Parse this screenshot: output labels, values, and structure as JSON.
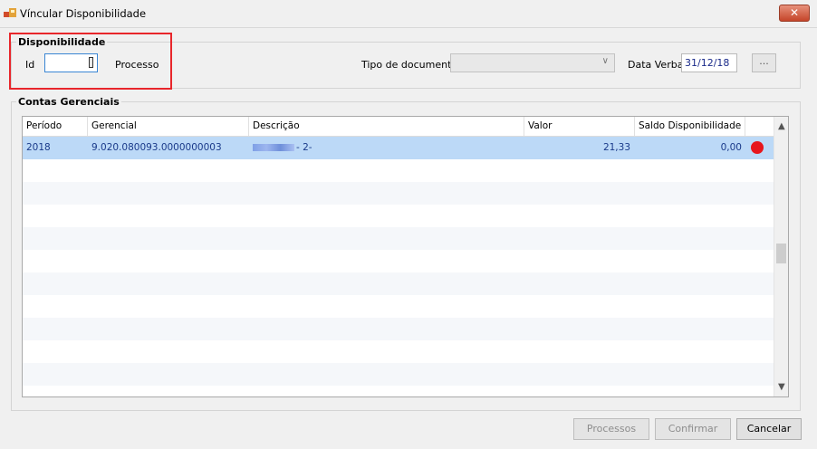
{
  "window": {
    "title": "Víncular Disponibilidade",
    "close_label": "✕"
  },
  "disponibilidade": {
    "legend": "Disponibilidade",
    "id_label": "Id",
    "id_value": "",
    "processo_label": "Processo",
    "tipo_documento_label": "Tipo de documento",
    "tipo_documento_value": "",
    "data_verba_label": "Data Verba",
    "data_verba_value": "31/12/18",
    "browse_label": "..."
  },
  "contas": {
    "legend": "Contas Gerenciais",
    "columns": [
      "Período",
      "Gerencial",
      "Descrição",
      "Valor",
      "Saldo Disponibilidade"
    ],
    "rows": [
      {
        "periodo": "2018",
        "gerencial": "9.020.080093.0000000003",
        "descricao": " - 2-",
        "valor": "21,33",
        "saldo": "0,00",
        "status_color": "#e7161d"
      }
    ]
  },
  "buttons": {
    "processos": "Processos",
    "confirmar": "Confirmar",
    "cancelar": "Cancelar"
  },
  "icons": {
    "scroll_up": "▲",
    "scroll_down": "▼",
    "combo_arrow": "∨"
  },
  "colors": {
    "selection": "#bcd9f7",
    "highlight_box": "#e8262b",
    "status_red": "#e7161d"
  }
}
